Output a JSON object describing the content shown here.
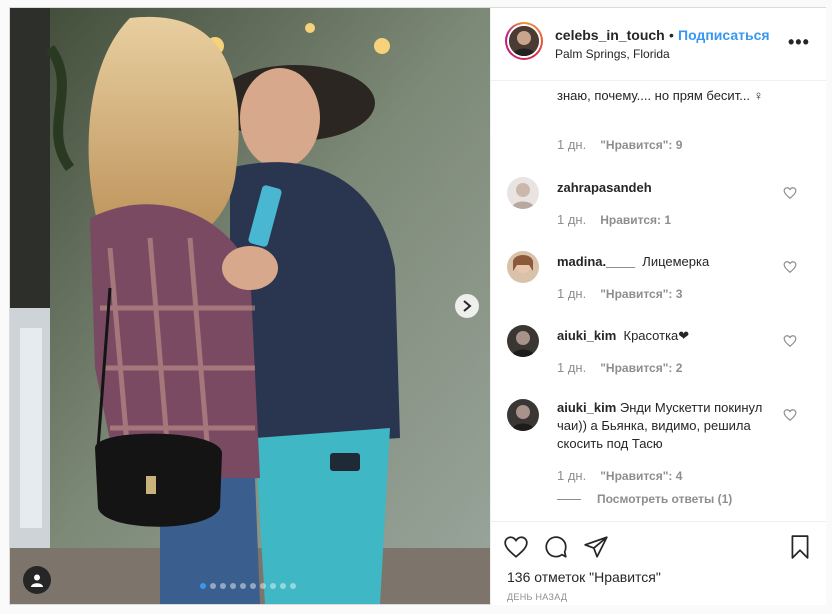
{
  "post": {
    "carousel": {
      "total_slides": 10,
      "active_slide": 1
    },
    "header": {
      "username": "celebs_in_touch",
      "separator": "•",
      "follow_label": "Подписаться",
      "location": "Palm Springs, Florida",
      "more_icon": "more-horizontal-icon"
    },
    "comments": [
      {
        "username": "",
        "text": "знаю, почему.... но прям бесит... ♀",
        "time": "1 дн.",
        "likes": "\"Нравится\": 9"
      },
      {
        "username": "zahrapasandeh",
        "text": "",
        "time": "1 дн.",
        "likes": "Нравится: 1"
      },
      {
        "username": "madina.____",
        "text": "Лицемерка",
        "time": "1 дн.",
        "likes": "\"Нравится\": 3"
      },
      {
        "username": "aiuki_kim",
        "text": "Красотка❤",
        "time": "1 дн.",
        "likes": "\"Нравится\": 2"
      },
      {
        "username": "aiuki_kim",
        "text": "Энди Мускетти покинул чаи)) а Бьянка, видимо, решила скосить под Тасю",
        "time": "1 дн.",
        "likes": "\"Нравится\": 4",
        "view_replies": "Посмотреть ответы (1)"
      }
    ],
    "footer": {
      "likes_total": "136 отметок \"Нравится\"",
      "posted_ago": "ДЕНЬ НАЗАД"
    },
    "icons": {
      "like": "heart-icon",
      "comment": "comment-icon",
      "share": "share-icon",
      "save": "bookmark-icon",
      "next": "chevron-right-icon",
      "tagged": "user-tag-icon"
    }
  }
}
